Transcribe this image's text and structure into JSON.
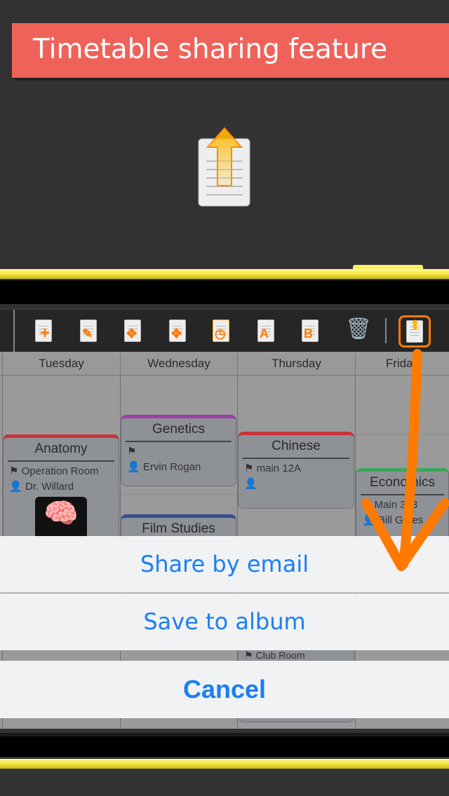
{
  "banner": {
    "title": "Timetable sharing feature",
    "color": "#ef6259"
  },
  "hero_icon": "document-upload-icon",
  "toolbar": {
    "icons": [
      "add-document-icon",
      "edit-document-icon",
      "move-a-icon",
      "move-b-icon",
      "timed-move-icon",
      "copy-a-icon",
      "copy-b-icon",
      "trash-icon",
      "share-icon"
    ],
    "highlight_color": "#ff7a00"
  },
  "days": [
    "Tuesday",
    "Wednesday",
    "Thursday",
    "Friday"
  ],
  "cards": [
    {
      "title": "Anatomy",
      "room": "Operation Room",
      "teacher": "Dr. Willard",
      "color": "#c8343d"
    },
    {
      "title": "Genetics",
      "room": "",
      "teacher": "Ervin Rogan",
      "color": "#9a3fa8"
    },
    {
      "title": "Film Studies",
      "color": "#33508f"
    },
    {
      "title": "Chinese",
      "room": "main 12A",
      "teacher": "",
      "color": "#c8343d"
    },
    {
      "title": "Economics",
      "room": "Main 303",
      "teacher": "Bill Gates",
      "color": "#3aa65a"
    },
    {
      "room": "Club Room"
    }
  ],
  "action_sheet": {
    "share_email": "Share by email",
    "save_album": "Save to album",
    "cancel": "Cancel",
    "accent": "#1a7ff5"
  }
}
